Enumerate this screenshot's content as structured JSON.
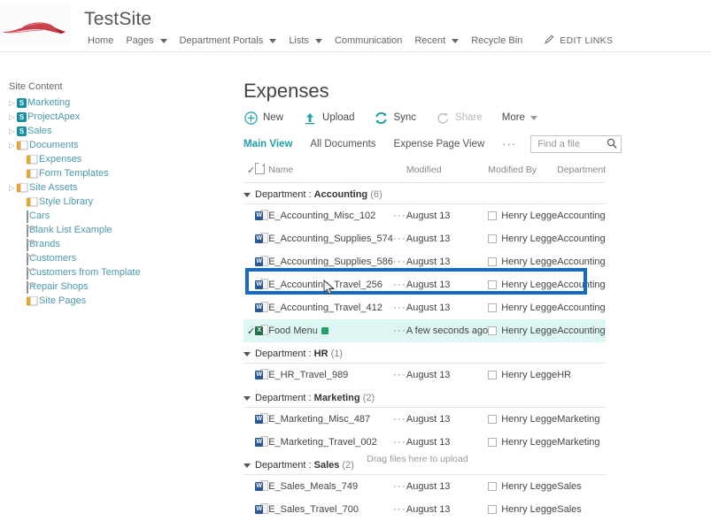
{
  "suite": {
    "site_title": "TestSite",
    "logo_icon": "red-car-logo",
    "nav": [
      {
        "label": "Home",
        "has_caret": false
      },
      {
        "label": "Pages",
        "has_caret": true
      },
      {
        "label": "Department Portals",
        "has_caret": true
      },
      {
        "label": "Lists",
        "has_caret": true
      },
      {
        "label": "Communication",
        "has_caret": false
      },
      {
        "label": "Recent",
        "has_caret": true
      },
      {
        "label": "Recycle Bin",
        "has_caret": false
      }
    ],
    "edit_links_label": "EDIT LINKS",
    "edit_links_icon": "pencil-icon"
  },
  "left_nav": {
    "heading": "Site Content",
    "items": [
      {
        "label": "Marketing",
        "icon": "sharepoint-site-icon",
        "expander": true,
        "indent": 0,
        "icon_type": "site"
      },
      {
        "label": "ProjectApex",
        "icon": "sharepoint-site-icon",
        "expander": true,
        "indent": 0,
        "icon_type": "site"
      },
      {
        "label": "Sales",
        "icon": "sharepoint-site-icon",
        "expander": true,
        "indent": 0,
        "icon_type": "site"
      },
      {
        "label": "Documents",
        "icon": "document-library-icon",
        "expander": true,
        "indent": 0,
        "icon_type": "lib"
      },
      {
        "label": "Expenses",
        "icon": "document-library-icon",
        "expander": false,
        "indent": 1,
        "icon_type": "lib"
      },
      {
        "label": "Form Templates",
        "icon": "document-library-icon",
        "expander": false,
        "indent": 1,
        "icon_type": "lib"
      },
      {
        "label": "Site Assets",
        "icon": "document-library-icon",
        "expander": true,
        "indent": 0,
        "icon_type": "lib"
      },
      {
        "label": "Style Library",
        "icon": "document-library-icon",
        "expander": false,
        "indent": 1,
        "icon_type": "lib"
      },
      {
        "label": "Cars",
        "icon": "picture-library-icon",
        "expander": false,
        "indent": 1,
        "icon_type": "pic"
      },
      {
        "label": "Blank List Example",
        "icon": "list-icon",
        "expander": false,
        "indent": 1,
        "icon_type": "list"
      },
      {
        "label": "Brands",
        "icon": "list-icon",
        "expander": false,
        "indent": 1,
        "icon_type": "list"
      },
      {
        "label": "Customers",
        "icon": "list-icon",
        "expander": false,
        "indent": 1,
        "icon_type": "list"
      },
      {
        "label": "Customers from Template",
        "icon": "list-icon",
        "expander": false,
        "indent": 1,
        "icon_type": "list"
      },
      {
        "label": "Repair Shops",
        "icon": "list-icon",
        "expander": false,
        "indent": 1,
        "icon_type": "list"
      },
      {
        "label": "Site Pages",
        "icon": "document-library-icon",
        "expander": false,
        "indent": 1,
        "icon_type": "lib"
      }
    ]
  },
  "main": {
    "page_title": "Expenses",
    "commands": [
      {
        "label": "New",
        "icon": "plus-circle-icon",
        "disabled": false
      },
      {
        "label": "Upload",
        "icon": "upload-arrow-icon",
        "disabled": false
      },
      {
        "label": "Sync",
        "icon": "sync-icon",
        "disabled": false
      },
      {
        "label": "Share",
        "icon": "share-icon",
        "disabled": true
      },
      {
        "label": "More",
        "icon": "chevron-down-icon",
        "disabled": false
      }
    ],
    "views": [
      {
        "label": "Main View",
        "active": true
      },
      {
        "label": "All Documents",
        "active": false
      },
      {
        "label": "Expense Page View",
        "active": false
      }
    ],
    "views_ellipsis": "···",
    "search": {
      "placeholder": "Find a file",
      "value": "",
      "icon": "search-icon"
    },
    "drag_hint": "Drag files here to upload"
  },
  "table": {
    "columns": {
      "check": "✓",
      "type": "",
      "name": "Name",
      "dots": "",
      "modified": "Modified",
      "modified_by": "Modified By",
      "department": "Department"
    },
    "groups": [
      {
        "field": "Department",
        "value": "Accounting",
        "count": "(6)",
        "rows": [
          {
            "name": "E_Accounting_Misc_102",
            "icon": "word-document-icon",
            "modified": "August 13",
            "modified_by": "Henry Legge",
            "department": "Accounting",
            "selected": false,
            "new_badge": false
          },
          {
            "name": "E_Accounting_Supplies_574",
            "icon": "word-document-icon",
            "modified": "August 13",
            "modified_by": "Henry Legge",
            "department": "Accounting",
            "selected": false,
            "new_badge": false
          },
          {
            "name": "E_Accounting_Supplies_586",
            "icon": "word-document-icon",
            "modified": "August 13",
            "modified_by": "Henry Legge",
            "department": "Accounting",
            "selected": false,
            "new_badge": false
          },
          {
            "name": "E_Accounting_Travel_256",
            "icon": "word-document-icon",
            "modified": "August 13",
            "modified_by": "Henry Legge",
            "department": "Accounting",
            "selected": false,
            "new_badge": false
          },
          {
            "name": "E_Accounting_Travel_412",
            "icon": "word-document-icon",
            "modified": "August 13",
            "modified_by": "Henry Legge",
            "department": "Accounting",
            "selected": false,
            "new_badge": false
          },
          {
            "name": "Food Menu",
            "icon": "excel-document-icon",
            "modified": "A few seconds ago",
            "modified_by": "Henry Legge",
            "department": "Accounting",
            "selected": true,
            "new_badge": true
          }
        ]
      },
      {
        "field": "Department",
        "value": "HR",
        "count": "(1)",
        "rows": [
          {
            "name": "E_HR_Travel_989",
            "icon": "word-document-icon",
            "modified": "August 13",
            "modified_by": "Henry Legge",
            "department": "HR",
            "selected": false,
            "new_badge": false
          }
        ]
      },
      {
        "field": "Department",
        "value": "Marketing",
        "count": "(2)",
        "rows": [
          {
            "name": "E_Marketing_Misc_487",
            "icon": "word-document-icon",
            "modified": "August 13",
            "modified_by": "Henry Legge",
            "department": "Marketing",
            "selected": false,
            "new_badge": false
          },
          {
            "name": "E_Marketing_Travel_002",
            "icon": "word-document-icon",
            "modified": "August 13",
            "modified_by": "Henry Legge",
            "department": "Marketing",
            "selected": false,
            "new_badge": false
          }
        ]
      },
      {
        "field": "Department",
        "value": "Sales",
        "count": "(2)",
        "rows": [
          {
            "name": "E_Sales_Meals_749",
            "icon": "word-document-icon",
            "modified": "August 13",
            "modified_by": "Henry Legge",
            "department": "Sales",
            "selected": false,
            "new_badge": false
          },
          {
            "name": "E_Sales_Travel_700",
            "icon": "word-document-icon",
            "modified": "August 13",
            "modified_by": "Henry Legge",
            "department": "Sales",
            "selected": false,
            "new_badge": false
          }
        ]
      }
    ]
  },
  "colors": {
    "accent_teal": "#21a0a6",
    "link_teal": "#4a9ab0",
    "selection_blue": "#1569c7",
    "selected_row_bg": "#def7f4",
    "word_blue": "#2b5797",
    "excel_green": "#1e7145",
    "new_badge_green": "#21a366"
  }
}
